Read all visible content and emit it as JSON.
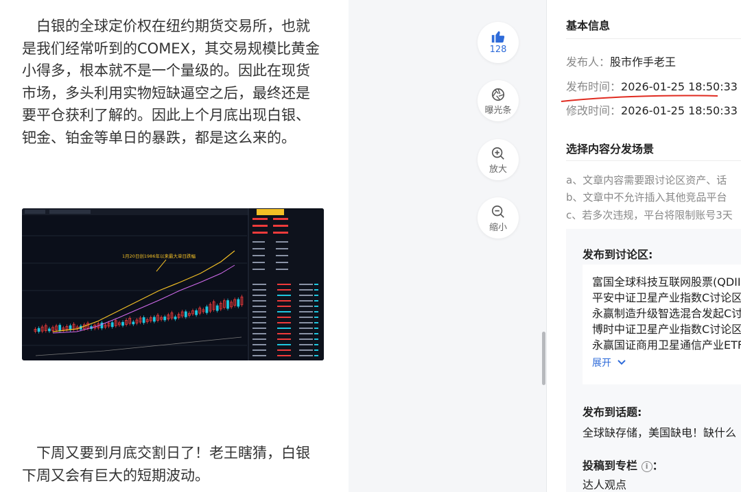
{
  "article": {
    "para1": "　白银的全球定价权在纽约期货交易所，也就是我们经常听到的COMEX，其交易规模比黄金小得多，根本就不是一个量级的。因此在现货市场，多头利用实物短缺逼空之后，最终还是要平仓获利了解的。因此上个月底出现白银、钯金、铂金等单日的暴跌，都是这么来的。",
    "para2": "　下周又要到月底交割日了！老王瞎猜，白银下周又会有巨大的短期波动。",
    "chart_annotation": "1月20日创1986年以来最大单日跌幅"
  },
  "actions": {
    "like_count": "128",
    "expose_label": "曝光条",
    "zoom_in_label": "放大",
    "zoom_out_label": "缩小"
  },
  "panel": {
    "basic_title": "基本信息",
    "publisher_label": "发布人：",
    "publisher_value": "股市作手老王",
    "publish_time_label": "发布时间：",
    "publish_time_value": "2026-01-25 18:50:33",
    "modify_time_label": "修改时间：",
    "modify_time_value": "2026-01-25 18:50:33",
    "scene_title": "选择内容分发场景",
    "rules": [
      "a、文章内容需要跟讨论区资产、话",
      "b、文章中不允许插入其他竞品平台",
      "c、若多次违规，平台将限制账号3天"
    ],
    "forum_title": "发布到讨论区:",
    "funds": [
      "富国全球科技互联网股票(QDII",
      "平安中证卫星产业指数C讨论区",
      "永赢制造升级智选混合发起C讨",
      "博时中证卫星产业指数C讨论区",
      "永赢国证商用卫星通信产业ETF"
    ],
    "expand_label": "展开",
    "topic_title": "发布到话题:",
    "topic_value": "全球缺存储，美国缺电！缺什么",
    "column_title": "投稿到专栏",
    "column_suffix": "：",
    "column_value": "达人观点"
  },
  "colors": {
    "accent": "#2e6bd9",
    "underline": "#e02a1f",
    "candle_up": "#ef3b3b",
    "candle_down": "#1fc7e0"
  }
}
